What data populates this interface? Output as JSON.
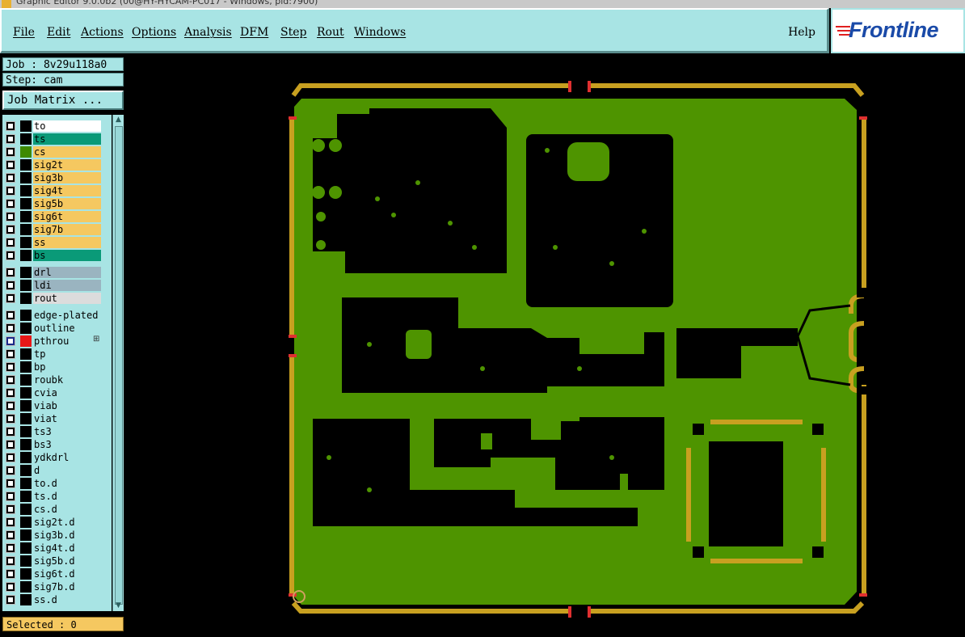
{
  "window": {
    "title": "Graphic Editor 9.0.0b2 (00@HY-HYCAM-PC017 - Windows, pid:7900)"
  },
  "menu": {
    "items": [
      "File",
      "Edit",
      "Actions",
      "Options",
      "Analysis",
      "DFM",
      "Step",
      "Rout",
      "Windows"
    ],
    "help": "Help"
  },
  "logo": {
    "text": "Frontline"
  },
  "panel": {
    "job": "Job : 8v29u118a0",
    "step": "Step: cam",
    "job_matrix": "Job Matrix ...",
    "status": "Selected : 0"
  },
  "layers": [
    {
      "name": "to",
      "color": "#ffffff",
      "swatch": "#000000"
    },
    {
      "name": "ts",
      "color": "#0a9a78",
      "swatch": "#000000"
    },
    {
      "name": "cs",
      "color": "#f5c860",
      "swatch": "#3e8a00"
    },
    {
      "name": "sig2t",
      "color": "#f5c860",
      "swatch": "#000000"
    },
    {
      "name": "sig3b",
      "color": "#f5c860",
      "swatch": "#000000"
    },
    {
      "name": "sig4t",
      "color": "#f5c860",
      "swatch": "#000000"
    },
    {
      "name": "sig5b",
      "color": "#f5c860",
      "swatch": "#000000"
    },
    {
      "name": "sig6t",
      "color": "#f5c860",
      "swatch": "#000000"
    },
    {
      "name": "sig7b",
      "color": "#f5c860",
      "swatch": "#000000"
    },
    {
      "name": "ss",
      "color": "#f5c860",
      "swatch": "#000000"
    },
    {
      "name": "bs",
      "color": "#0a9a78",
      "swatch": "#000000"
    },
    {
      "name": "drl",
      "color": "#9ab4c0",
      "swatch": "#000000"
    },
    {
      "name": "ldi",
      "color": "#9ab4c0",
      "swatch": "#000000"
    },
    {
      "name": "rout",
      "color": "#dcdcdc",
      "swatch": "#000000"
    },
    {
      "name": "edge-plated",
      "color": "#a8e4e4",
      "swatch": "#000000"
    },
    {
      "name": "outline",
      "color": "#a8e4e4",
      "swatch": "#000000"
    },
    {
      "name": "pthrou",
      "color": "#a8e4e4",
      "swatch": "#e81818",
      "active": true
    },
    {
      "name": "tp",
      "color": "#a8e4e4",
      "swatch": "#000000"
    },
    {
      "name": "bp",
      "color": "#a8e4e4",
      "swatch": "#000000"
    },
    {
      "name": "roubk",
      "color": "#a8e4e4",
      "swatch": "#000000"
    },
    {
      "name": "cvia",
      "color": "#a8e4e4",
      "swatch": "#000000"
    },
    {
      "name": "viab",
      "color": "#a8e4e4",
      "swatch": "#000000"
    },
    {
      "name": "viat",
      "color": "#a8e4e4",
      "swatch": "#000000"
    },
    {
      "name": "ts3",
      "color": "#a8e4e4",
      "swatch": "#000000"
    },
    {
      "name": "bs3",
      "color": "#a8e4e4",
      "swatch": "#000000"
    },
    {
      "name": "ydkdrl",
      "color": "#a8e4e4",
      "swatch": "#000000"
    },
    {
      "name": "d",
      "color": "#a8e4e4",
      "swatch": "#000000"
    },
    {
      "name": "to.d",
      "color": "#a8e4e4",
      "swatch": "#000000"
    },
    {
      "name": "ts.d",
      "color": "#a8e4e4",
      "swatch": "#000000"
    },
    {
      "name": "cs.d",
      "color": "#a8e4e4",
      "swatch": "#000000"
    },
    {
      "name": "sig2t.d",
      "color": "#a8e4e4",
      "swatch": "#000000"
    },
    {
      "name": "sig3b.d",
      "color": "#a8e4e4",
      "swatch": "#000000"
    },
    {
      "name": "sig4t.d",
      "color": "#a8e4e4",
      "swatch": "#000000"
    },
    {
      "name": "sig5b.d",
      "color": "#a8e4e4",
      "swatch": "#000000"
    },
    {
      "name": "sig6t.d",
      "color": "#a8e4e4",
      "swatch": "#000000"
    },
    {
      "name": "sig7b.d",
      "color": "#a8e4e4",
      "swatch": "#000000"
    },
    {
      "name": "ss.d",
      "color": "#a8e4e4",
      "swatch": "#000000"
    }
  ],
  "colors": {
    "board": "#4e9400",
    "copper": "#000000",
    "rail": "#c8a020",
    "rail_edge": "#e03030",
    "ui": "#a8e4e4"
  },
  "icons": {
    "expand": "plus-box-icon",
    "scroll_up": "arrow-up-icon",
    "scroll_down": "arrow-down-icon"
  }
}
